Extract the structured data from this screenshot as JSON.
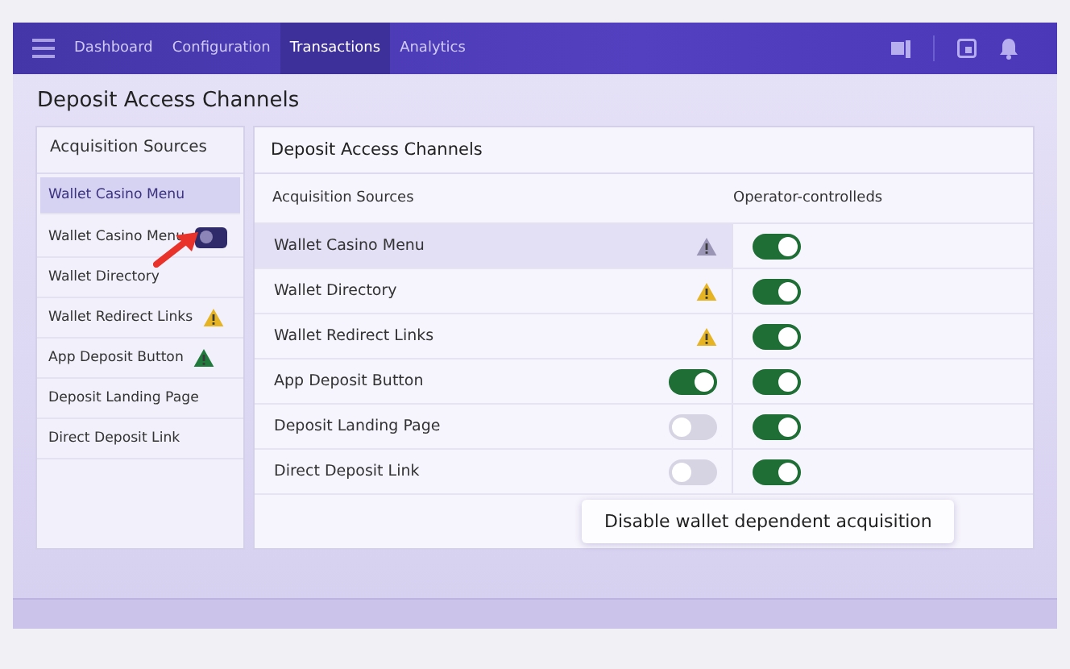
{
  "nav": {
    "tabs": [
      {
        "label": "Dashboard",
        "selected": false
      },
      {
        "label": "Configuration",
        "selected": false
      },
      {
        "label": "Transactions",
        "selected": true
      },
      {
        "label": "Analytics",
        "selected": false
      }
    ]
  },
  "page_title": "Deposit Access Channels",
  "sidebar": {
    "title": "Acquisition Sources",
    "items": [
      {
        "label": "Wallet Casino Menu",
        "selected": true,
        "kind": "plain"
      },
      {
        "label": "Wallet Casino Menu",
        "selected": false,
        "kind": "toggle",
        "on": false
      },
      {
        "label": "Wallet Directory",
        "selected": false,
        "kind": "plain"
      },
      {
        "label": "Wallet Redirect Links",
        "selected": false,
        "kind": "warning",
        "color": "#e6b422"
      },
      {
        "label": "App Deposit Button",
        "selected": false,
        "kind": "warning",
        "color": "#1f7a3c"
      },
      {
        "label": "Deposit Landing Page",
        "selected": false,
        "kind": "plain"
      },
      {
        "label": "Direct Deposit Link",
        "selected": false,
        "kind": "plain"
      }
    ]
  },
  "panel": {
    "title": "Deposit Access Channels",
    "columns": [
      "Acquisition Sources",
      "Operator-controlleds"
    ],
    "rows": [
      {
        "source": "Wallet Casino Menu",
        "selected": true,
        "kind": "warning",
        "color": "#9a95b5",
        "operator_on": true
      },
      {
        "source": "Wallet Directory",
        "selected": false,
        "kind": "warning",
        "color": "#e6b422",
        "operator_on": true
      },
      {
        "source": "Wallet Redirect Links",
        "selected": false,
        "kind": "warning",
        "color": "#e6b422",
        "operator_on": true
      },
      {
        "source": "App Deposit Button",
        "selected": false,
        "kind": "toggle",
        "on": true,
        "operator_on": true
      },
      {
        "source": "Deposit Landing Page",
        "selected": false,
        "kind": "toggle",
        "on": false,
        "operator_on": true
      },
      {
        "source": "Direct Deposit Link",
        "selected": false,
        "kind": "toggle",
        "on": false,
        "operator_on": true
      }
    ]
  },
  "tooltip": "Disable wallet dependent acquisition"
}
